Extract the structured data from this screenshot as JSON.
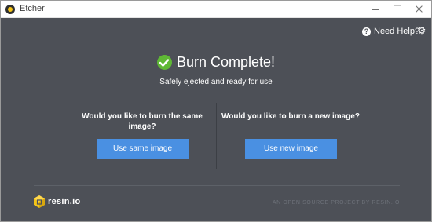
{
  "window": {
    "title": "Etcher"
  },
  "header": {
    "help_label": "Need Help?",
    "help_icon": "question-circle-icon",
    "settings_icon": "gear-icon"
  },
  "status": {
    "title": "Burn Complete!",
    "subtitle": "Safely ejected and ready for use",
    "icon": "checkmark-icon",
    "icon_color": "#5fb835"
  },
  "options": {
    "same": {
      "question": "Would you like to burn the same image?",
      "button_label": "Use same image"
    },
    "new": {
      "question": "Would you like to burn a new image?",
      "button_label": "Use new image"
    }
  },
  "footer": {
    "logo_text": "resin.io",
    "tagline": "AN OPEN SOURCE PROJECT BY RESIN.IO"
  },
  "colors": {
    "background": "#4d5057",
    "accent_button": "#4a90e2",
    "logo_yellow": "#f5c518"
  }
}
